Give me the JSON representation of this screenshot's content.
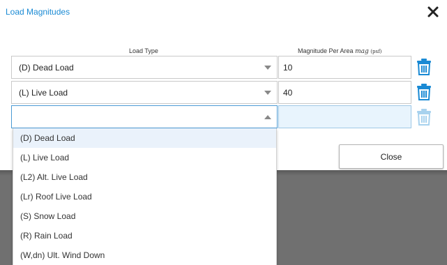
{
  "dialog": {
    "title": "Load Magnitudes",
    "close_label": "Close"
  },
  "headers": {
    "load_type": "Load Type",
    "magnitude_prefix": "Magnitude Per Area",
    "magnitude_symbol": "mag",
    "magnitude_unit": "(psf)"
  },
  "rows": [
    {
      "load_type": "(D) Dead Load",
      "magnitude": "10"
    },
    {
      "load_type": "(L) Live Load",
      "magnitude": "40"
    },
    {
      "load_type": "",
      "magnitude": ""
    }
  ],
  "dropdown": {
    "highlighted_index": 0,
    "options": [
      "(D) Dead Load",
      "(L) Live Load",
      "(L2) Alt. Live Load",
      "(Lr) Roof Live Load",
      "(S) Snow Load",
      "(R) Rain Load",
      "(W,dn) Ult. Wind Down"
    ]
  },
  "colors": {
    "accent": "#1a8ad4",
    "highlight": "#eaf2fb",
    "active_input": "#e8f4fd",
    "trash_active": "#1a8ad4",
    "trash_disabled": "#a8d2ee"
  },
  "icons": {
    "close": "close-x-icon",
    "trash": "trash-icon"
  }
}
